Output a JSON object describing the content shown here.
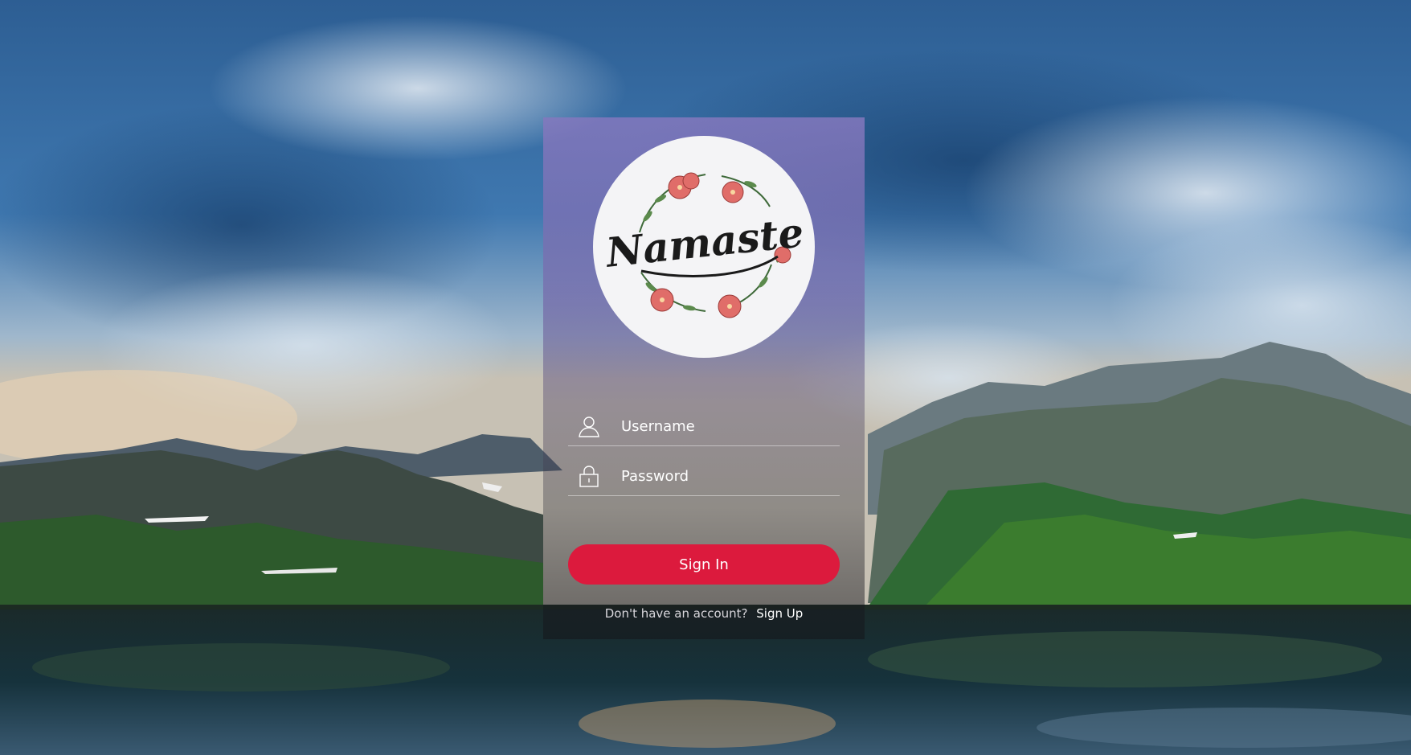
{
  "login": {
    "logo_text": "Namaste",
    "username_placeholder": "Username",
    "password_placeholder": "Password",
    "signin_label": "Sign In",
    "signup_prompt": "Don't have an account?",
    "signup_label": "Sign Up"
  },
  "icons": {
    "username": "user-icon",
    "password": "lock-icon"
  },
  "colors": {
    "accent": "#dc1a3d"
  }
}
